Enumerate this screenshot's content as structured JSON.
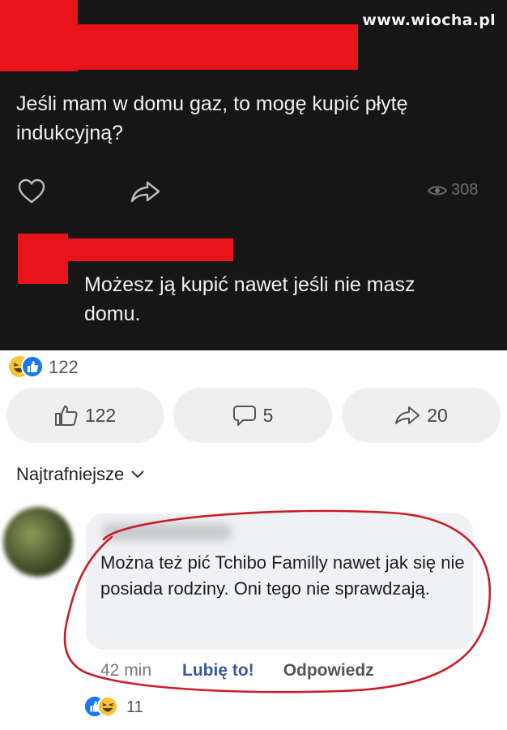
{
  "watermark": "www.wiocha.pl",
  "question": {
    "text": "Jeśli mam w domu gaz, to mogę kupić płytę indukcyjną?",
    "views": "308"
  },
  "answer": {
    "text": "Możesz ją kupić nawet jeśli nie masz domu."
  },
  "post_stats": {
    "reactions_count": "122",
    "like_count": "122",
    "comment_count": "5",
    "share_count": "20"
  },
  "comments": {
    "sort_label": "Najtrafniejsze",
    "items": [
      {
        "text": "Można też pić Tchibo Familly nawet jak się nie posiada rodziny. Oni tego nie sprawdzają.",
        "time": "42 min",
        "like_label": "Lubię to!",
        "reply_label": "Odpowiedz",
        "reactions_count": "11"
      }
    ]
  },
  "colors": {
    "dark_bg": "#161616",
    "redaction": "#e8141a",
    "pill_bg": "#efefef",
    "link_blue": "#3b5998",
    "circle_red": "#c81e28"
  },
  "icons": [
    "heart-icon",
    "share-icon",
    "eye-icon",
    "haha-reaction-icon",
    "like-reaction-icon",
    "thumbs-up-icon",
    "comment-icon",
    "chevron-down-icon"
  ]
}
